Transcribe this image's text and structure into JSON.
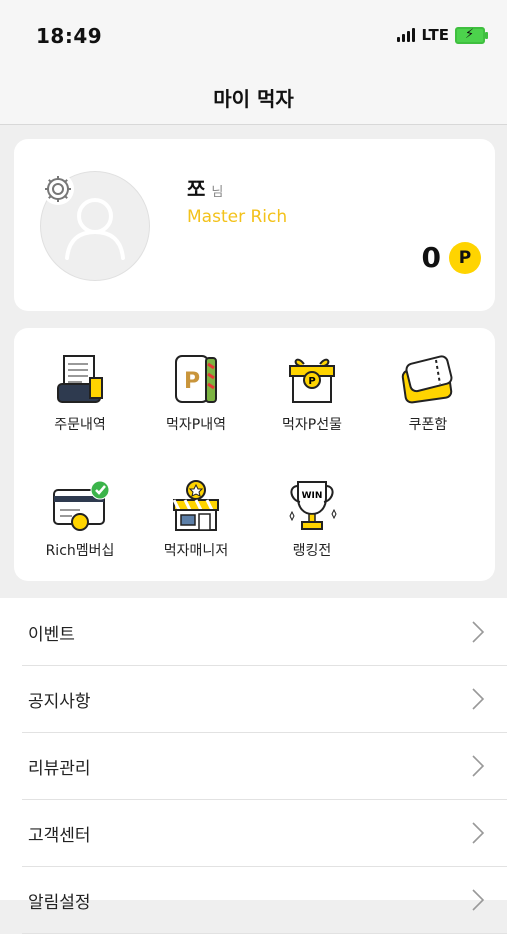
{
  "status_bar": {
    "time": "18:49",
    "network": "LTE"
  },
  "header": {
    "title": "마이 먹자"
  },
  "profile": {
    "name": "쪼",
    "honorific": "님",
    "grade": "Master Rich",
    "points": "0",
    "point_symbol": "P",
    "grade_color": "#f3c21b"
  },
  "menu": {
    "items": [
      {
        "label": "주문내역",
        "icon": "receipt-icon"
      },
      {
        "label": "먹자P내역",
        "icon": "sandwich-points-icon"
      },
      {
        "label": "먹자P선물",
        "icon": "gift-box-icon"
      },
      {
        "label": "쿠폰함",
        "icon": "coupon-icon"
      },
      {
        "label": "Rich멤버십",
        "icon": "membership-card-icon"
      },
      {
        "label": "먹자매니저",
        "icon": "store-manager-icon"
      },
      {
        "label": "랭킹전",
        "icon": "trophy-icon"
      }
    ]
  },
  "list": {
    "items": [
      {
        "label": "이벤트"
      },
      {
        "label": "공지사항"
      },
      {
        "label": "리뷰관리"
      },
      {
        "label": "고객센터"
      },
      {
        "label": "알림설정"
      }
    ]
  },
  "colors": {
    "accent": "#ffd400",
    "background": "#efefef"
  }
}
